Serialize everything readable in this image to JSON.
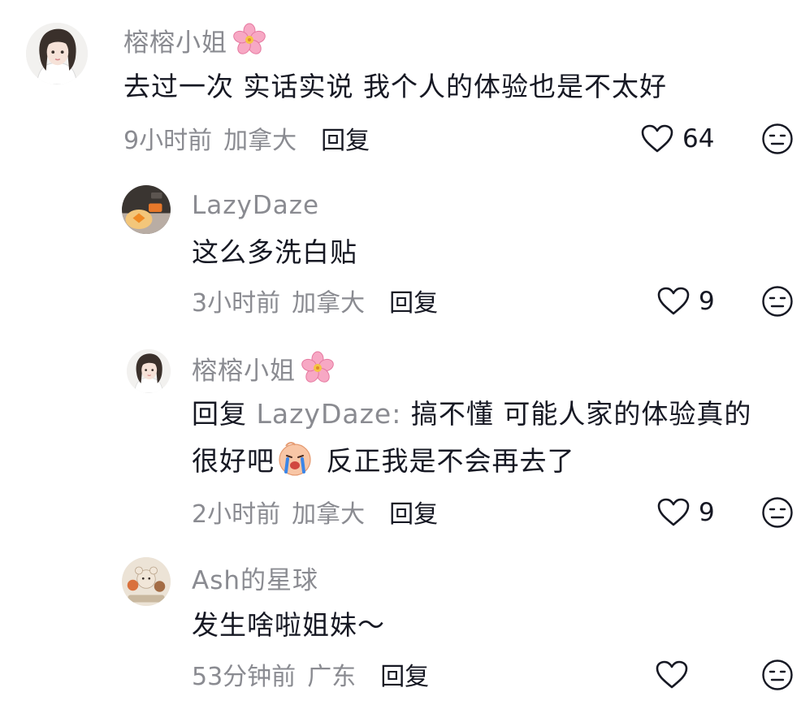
{
  "comments": [
    {
      "user": "榕榕小姐",
      "text": "去过一次 实话实说 我个人的体验也是不太好",
      "time": "9小时前",
      "location": "加拿大",
      "reply_label": "回复",
      "likes": "64",
      "avatar_icon": "girl-avatar"
    },
    {
      "user": "LazyDaze",
      "text": "这么多洗白贴",
      "time": "3小时前",
      "location": "加拿大",
      "reply_label": "回复",
      "likes": "9",
      "avatar_icon": "food-photo-avatar"
    },
    {
      "user": "榕榕小姐",
      "reply_prefix": "回复",
      "reply_target": "LazyDaze:",
      "text_line1": "搞不懂 可能人家的体验真的",
      "text_line2a": "很好吧",
      "text_line2b": "反正我是不会再去了",
      "time": "2小时前",
      "location": "加拿大",
      "reply_label": "回复",
      "likes": "9",
      "avatar_icon": "girl-avatar",
      "emoji_icon": "crying-emoji"
    },
    {
      "user": "Ash的星球",
      "text": "发生啥啦姐妹～",
      "time": "53分钟前",
      "location": "广东",
      "reply_label": "回复",
      "likes": "",
      "avatar_icon": "toys-photo-avatar"
    }
  ],
  "colors": {
    "text": "#161823",
    "muted": "#8a8b91",
    "flower": "#f7a8c4"
  }
}
